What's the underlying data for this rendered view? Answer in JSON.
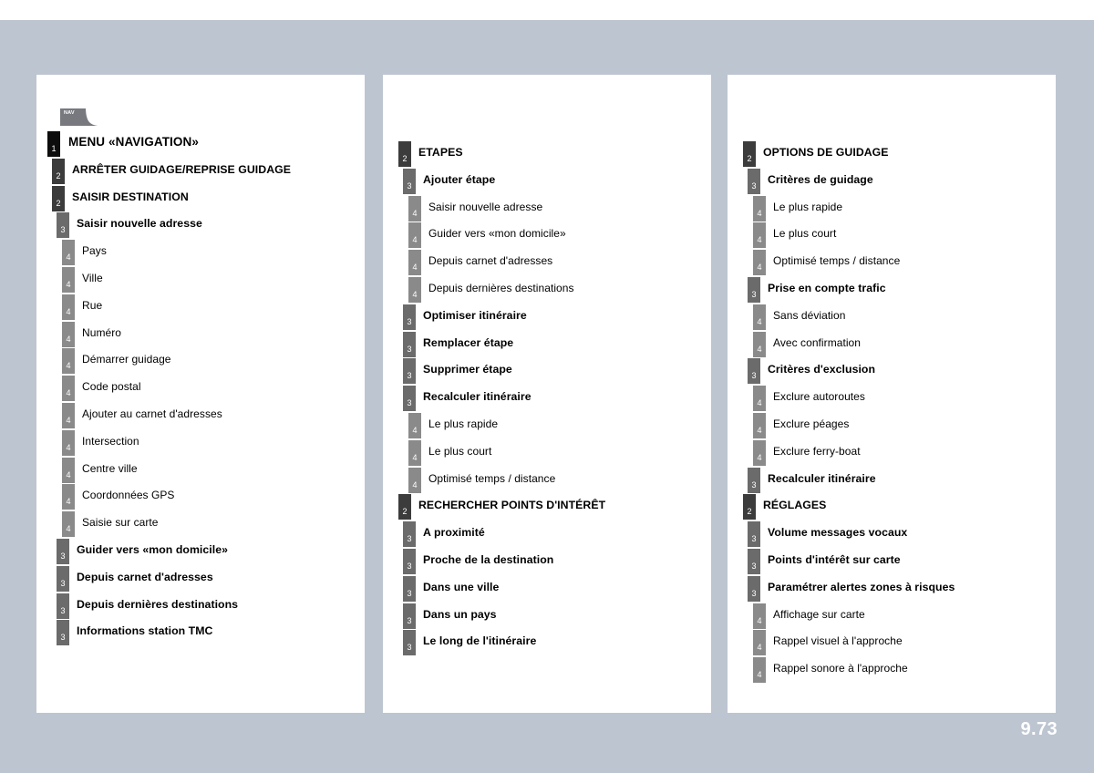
{
  "page": {
    "number": "9.73",
    "nav_tab_label": "NAV",
    "background_color": "#bdc5d1",
    "panel_color": "#ffffff"
  },
  "badge_colors": {
    "level_1": "#0d0d0d",
    "level_2": "#3c3c3c",
    "level_3": "#6b6b6b",
    "level_4": "#8a8a8a"
  },
  "columns": [
    {
      "id": "column-1",
      "items": [
        {
          "level": 1,
          "badge": "1",
          "label": "MENU «NAVIGATION»"
        },
        {
          "level": 2,
          "badge": "2",
          "label": "ARRÊTER GUIDAGE/REPRISE GUIDAGE"
        },
        {
          "level": 2,
          "badge": "2",
          "label": "SAISIR DESTINATION"
        },
        {
          "level": 3,
          "badge": "3",
          "label": "Saisir nouvelle adresse"
        },
        {
          "level": 4,
          "badge": "4",
          "label": "Pays"
        },
        {
          "level": 4,
          "badge": "4",
          "label": "Ville"
        },
        {
          "level": 4,
          "badge": "4",
          "label": "Rue"
        },
        {
          "level": 4,
          "badge": "4",
          "label": "Numéro"
        },
        {
          "level": 4,
          "badge": "4",
          "label": "Démarrer guidage"
        },
        {
          "level": 4,
          "badge": "4",
          "label": "Code postal"
        },
        {
          "level": 4,
          "badge": "4",
          "label": "Ajouter au carnet d'adresses"
        },
        {
          "level": 4,
          "badge": "4",
          "label": "Intersection"
        },
        {
          "level": 4,
          "badge": "4",
          "label": "Centre ville"
        },
        {
          "level": 4,
          "badge": "4",
          "label": "Coordonnées GPS"
        },
        {
          "level": 4,
          "badge": "4",
          "label": "Saisie sur carte"
        },
        {
          "level": 3,
          "badge": "3",
          "label": "Guider vers «mon domicile»"
        },
        {
          "level": 3,
          "badge": "3",
          "label": "Depuis carnet d'adresses"
        },
        {
          "level": 3,
          "badge": "3",
          "label": "Depuis dernières destinations"
        },
        {
          "level": 3,
          "badge": "3",
          "label": "Informations station TMC"
        }
      ]
    },
    {
      "id": "column-2",
      "items": [
        {
          "level": 2,
          "badge": "2",
          "label": "ETAPES"
        },
        {
          "level": 3,
          "badge": "3",
          "label": "Ajouter étape"
        },
        {
          "level": 4,
          "badge": "4",
          "label": "Saisir nouvelle adresse"
        },
        {
          "level": 4,
          "badge": "4",
          "label": "Guider vers «mon domicile»"
        },
        {
          "level": 4,
          "badge": "4",
          "label": "Depuis carnet d'adresses"
        },
        {
          "level": 4,
          "badge": "4",
          "label": "Depuis dernières destinations"
        },
        {
          "level": 3,
          "badge": "3",
          "label": "Optimiser itinéraire"
        },
        {
          "level": 3,
          "badge": "3",
          "label": "Remplacer étape"
        },
        {
          "level": 3,
          "badge": "3",
          "label": "Supprimer étape"
        },
        {
          "level": 3,
          "badge": "3",
          "label": "Recalculer itinéraire"
        },
        {
          "level": 4,
          "badge": "4",
          "label": "Le plus rapide"
        },
        {
          "level": 4,
          "badge": "4",
          "label": "Le plus court"
        },
        {
          "level": 4,
          "badge": "4",
          "label": "Optimisé temps / distance"
        },
        {
          "level": 2,
          "badge": "2",
          "label": "RECHERCHER POINTS D'INTÉRÊT"
        },
        {
          "level": 3,
          "badge": "3",
          "label": "A proximité"
        },
        {
          "level": 3,
          "badge": "3",
          "label": "Proche de la destination"
        },
        {
          "level": 3,
          "badge": "3",
          "label": "Dans une ville"
        },
        {
          "level": 3,
          "badge": "3",
          "label": "Dans un pays"
        },
        {
          "level": 3,
          "badge": "3",
          "label": "Le long de l'itinéraire"
        }
      ]
    },
    {
      "id": "column-3",
      "items": [
        {
          "level": 2,
          "badge": "2",
          "label": "OPTIONS DE GUIDAGE"
        },
        {
          "level": 3,
          "badge": "3",
          "label": "Critères de guidage"
        },
        {
          "level": 4,
          "badge": "4",
          "label": "Le plus rapide"
        },
        {
          "level": 4,
          "badge": "4",
          "label": "Le plus court"
        },
        {
          "level": 4,
          "badge": "4",
          "label": "Optimisé temps / distance"
        },
        {
          "level": 3,
          "badge": "3",
          "label": "Prise en compte trafic"
        },
        {
          "level": 4,
          "badge": "4",
          "label": "Sans déviation"
        },
        {
          "level": 4,
          "badge": "4",
          "label": "Avec confirmation"
        },
        {
          "level": 3,
          "badge": "3",
          "label": "Critères d'exclusion"
        },
        {
          "level": 4,
          "badge": "4",
          "label": "Exclure autoroutes"
        },
        {
          "level": 4,
          "badge": "4",
          "label": "Exclure péages"
        },
        {
          "level": 4,
          "badge": "4",
          "label": "Exclure ferry-boat"
        },
        {
          "level": 3,
          "badge": "3",
          "label": "Recalculer itinéraire"
        },
        {
          "level": 2,
          "badge": "2",
          "label": "RÉGLAGES"
        },
        {
          "level": 3,
          "badge": "3",
          "label": "Volume messages vocaux"
        },
        {
          "level": 3,
          "badge": "3",
          "label": "Points d'intérêt sur carte"
        },
        {
          "level": 3,
          "badge": "3",
          "label": "Paramétrer alertes zones à risques"
        },
        {
          "level": 4,
          "badge": "4",
          "label": "Affichage sur carte"
        },
        {
          "level": 4,
          "badge": "4",
          "label": "Rappel visuel à l'approche"
        },
        {
          "level": 4,
          "badge": "4",
          "label": "Rappel sonore à l'approche"
        }
      ]
    }
  ]
}
